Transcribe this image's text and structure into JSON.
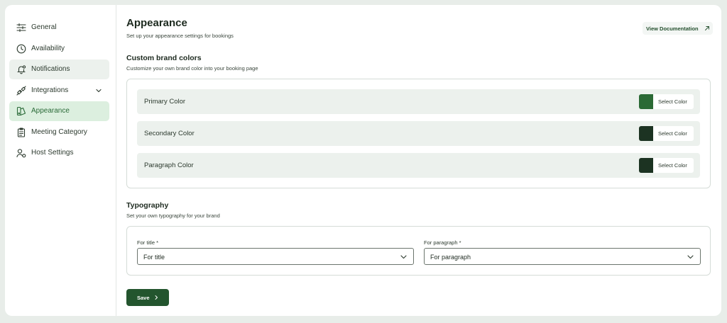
{
  "sidebar": {
    "items": [
      {
        "label": "General",
        "icon": "sliders-icon"
      },
      {
        "label": "Availability",
        "icon": "clock-icon"
      },
      {
        "label": "Notifications",
        "icon": "bell-icon"
      },
      {
        "label": "Integrations",
        "icon": "plug-icon"
      },
      {
        "label": "Appearance",
        "icon": "palette-icon"
      },
      {
        "label": "Meeting Category",
        "icon": "clipboard-icon"
      },
      {
        "label": "Host Settings",
        "icon": "user-settings-icon"
      }
    ],
    "active": "Appearance"
  },
  "header": {
    "title": "Appearance",
    "subtitle": "Set up your appearance settings for bookings",
    "doc_link": "View Documentation"
  },
  "brand_colors": {
    "title": "Custom brand colors",
    "subtitle": "Customize your own brand color into your booking page",
    "rows": [
      {
        "label": "Primary Color",
        "button": "Select Color",
        "color": "#2b6a35"
      },
      {
        "label": "Secondary Color",
        "button": "Select Color",
        "color": "#1c3322"
      },
      {
        "label": "Paragraph Color",
        "button": "Select Color",
        "color": "#1c3322"
      }
    ]
  },
  "typography": {
    "title": "Typography",
    "subtitle": "Set your own typography for your brand",
    "title_field": {
      "label": "For title *",
      "value": "For title"
    },
    "paragraph_field": {
      "label": "For paragraph *",
      "value": "For paragraph"
    }
  },
  "save_label": "Save",
  "colors": {
    "accent": "#23552e",
    "active_bg": "#dcefdf",
    "page_bg": "#e8ede9"
  }
}
